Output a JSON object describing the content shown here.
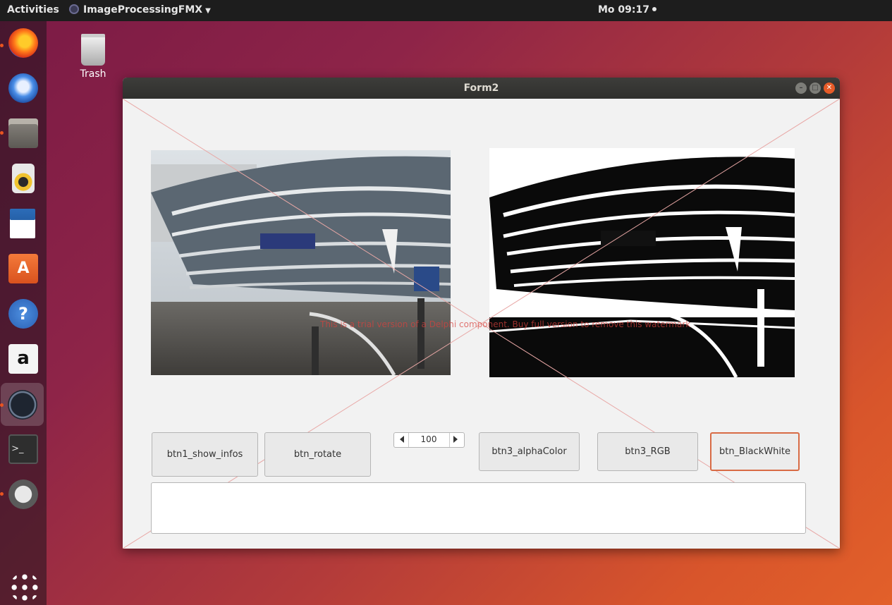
{
  "topbar": {
    "activities_label": "Activities",
    "app_menu_label": "ImageProcessingFMX",
    "clock": "Mo 09:17"
  },
  "dock": {
    "items": [
      "firefox-icon",
      "thunderbird-icon",
      "files-icon",
      "rhythmbox-icon",
      "libreoffice-writer-icon",
      "software-center-icon",
      "help-icon",
      "amazon-icon",
      "delphi-paserver-icon",
      "terminal-icon",
      "software-updater-icon",
      "show-apps-icon"
    ]
  },
  "desktop": {
    "trash_label": "Trash"
  },
  "window": {
    "title": "Form2",
    "watermark_text": "This is a trial version of a Delphi component. Buy full version to remove this watermark"
  },
  "controls": {
    "btn_show_infos": "btn1_show_infos",
    "btn_rotate": "btn_rotate",
    "spin_value": "100",
    "btn_alpha": "btn3_alphaColor",
    "btn_rgb": "btn3_RGB",
    "btn_bw": "btn_BlackWhite"
  },
  "colors": {
    "accent": "#e95420",
    "focus_border": "#d86b45",
    "watermark": "#d9413d"
  }
}
